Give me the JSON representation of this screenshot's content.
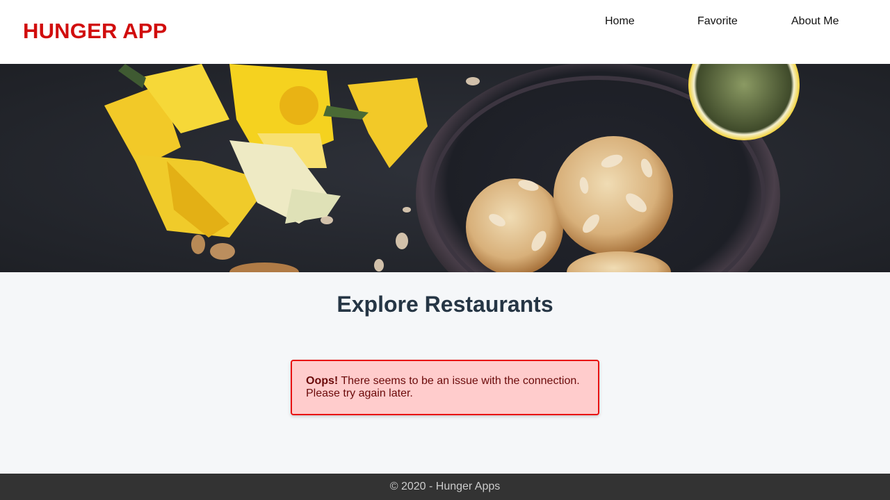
{
  "header": {
    "brand": "HUNGER APP",
    "nav": [
      {
        "label": "Home"
      },
      {
        "label": "Favorite"
      },
      {
        "label": "About Me"
      }
    ]
  },
  "hero": {
    "image": "food-hero-image"
  },
  "main": {
    "title": "Explore Restaurants",
    "error": {
      "strong": "Oops!",
      "message": " There seems to be an issue with the connection. Please try again later."
    }
  },
  "footer": {
    "text": "© 2020 - Hunger Apps"
  },
  "colors": {
    "brand": "#d10d0d",
    "error_bg": "#ffcccc",
    "error_border": "#e81111",
    "footer_bg": "#333333"
  }
}
